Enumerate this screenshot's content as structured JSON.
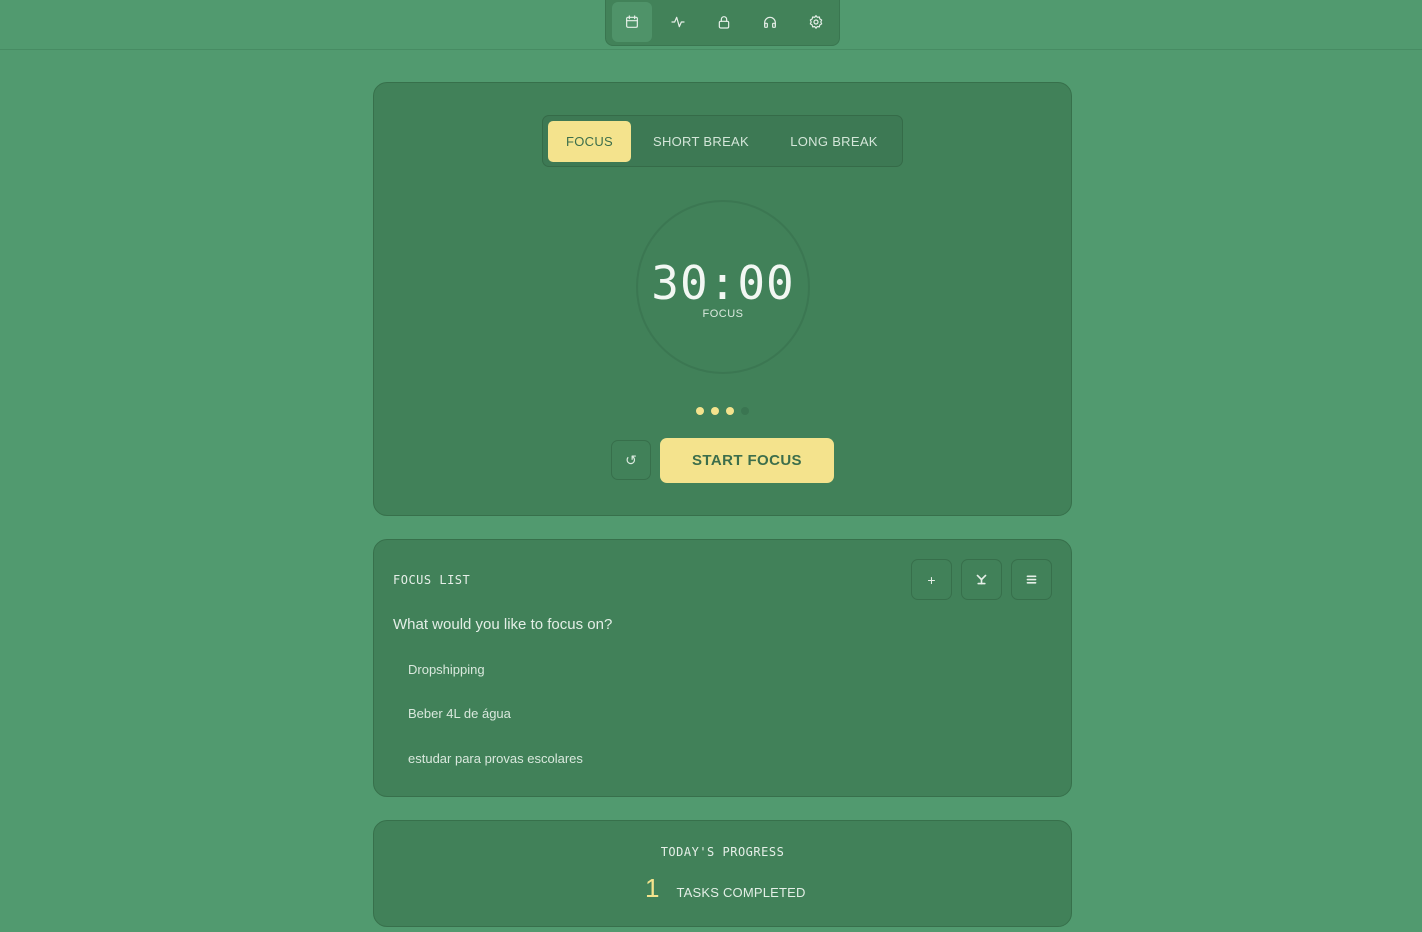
{
  "colors": {
    "background": "#519a6f",
    "card": "#418159",
    "accent": "#f4e38d"
  },
  "nav": {
    "items": [
      {
        "icon": "calendar-icon",
        "active": true
      },
      {
        "icon": "activity-icon",
        "active": false
      },
      {
        "icon": "lock-icon",
        "active": false
      },
      {
        "icon": "headphones-icon",
        "active": false
      },
      {
        "icon": "gear-icon",
        "active": false
      }
    ]
  },
  "timer": {
    "modes": [
      "FOCUS",
      "SHORT BREAK",
      "LONG BREAK"
    ],
    "selected_mode": "FOCUS",
    "time": "30:00",
    "label": "FOCUS",
    "sessions_total": 4,
    "sessions_completed": 3,
    "reset_icon": "↺",
    "start_label": "START FOCUS"
  },
  "focus_list": {
    "title": "FOCUS LIST",
    "prompt": "What would you like to focus on?",
    "tasks": [
      "Dropshipping",
      "Beber 4L de água",
      "estudar para provas escolares"
    ],
    "add_icon": "+"
  },
  "progress": {
    "title": "TODAY'S PROGRESS",
    "count": "1",
    "label": "TASKS COMPLETED"
  }
}
